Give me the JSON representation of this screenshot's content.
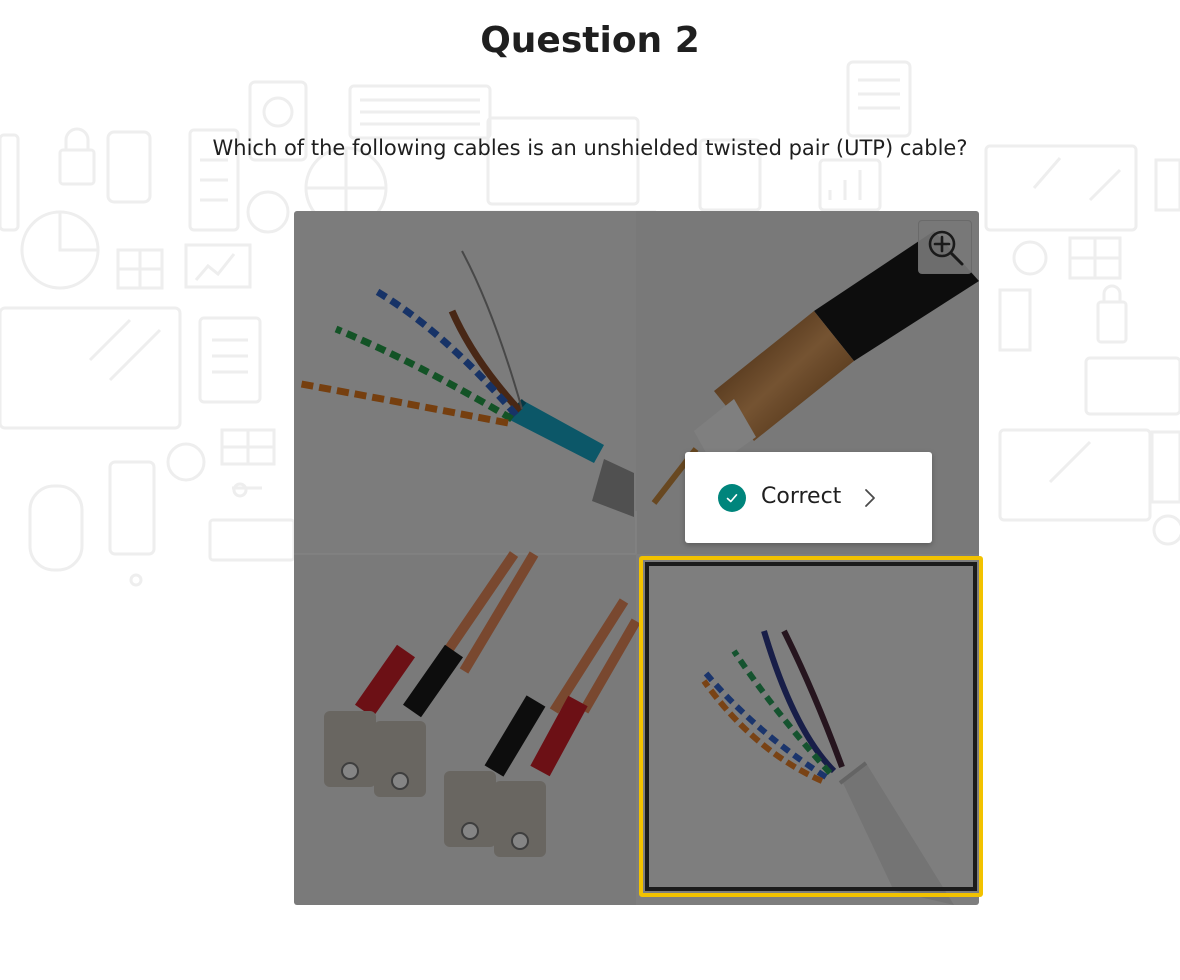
{
  "page": {
    "title": "Question 2",
    "question": "Which of the following cables is an unshielded twisted pair (UTP) cable?"
  },
  "image": {
    "panels": [
      {
        "name": "shielded-twisted-pair-cable"
      },
      {
        "name": "coaxial-cable"
      },
      {
        "name": "fiber-optic-sc-connectors"
      },
      {
        "name": "unshielded-twisted-pair-cable"
      }
    ]
  },
  "feedback": {
    "label": "Correct",
    "status": "correct",
    "icon": "check-circle-icon",
    "arrow_icon": "chevron-right-icon"
  },
  "zoom": {
    "icon": "zoom-in-icon"
  },
  "colors": {
    "accent_correct": "#00857c",
    "selection_highlight": "#f2c200",
    "overlay": "rgba(0,0,0,0.48)"
  }
}
